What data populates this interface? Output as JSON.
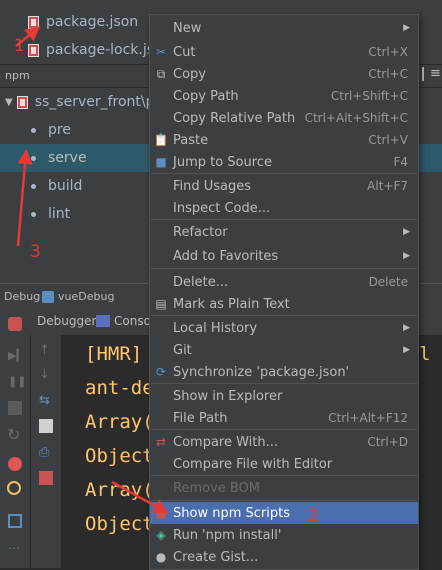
{
  "project_tree": {
    "files": [
      "package.json",
      "package-lock.json"
    ],
    "npm_label": "npm",
    "root_node": "ss_server_front\\package.json",
    "scripts": [
      "pre",
      "serve",
      "build",
      "lint"
    ]
  },
  "debug": {
    "tool_window_label": "Debug",
    "config_name": "vueDebug",
    "tabs": [
      "Debugger",
      "Console"
    ],
    "console_lines": [
      "[HMR]",
      "ant-de",
      "Array(",
      "Object",
      "Array(",
      "Object"
    ],
    "console_line_tail": "l"
  },
  "context_menu": {
    "items": [
      {
        "label": "New",
        "submenu": true
      },
      {
        "label": "Cut",
        "key": "Ctrl+X",
        "icon": "scissors-icon"
      },
      {
        "label": "Copy",
        "key": "Ctrl+C",
        "icon": "copy-icon"
      },
      {
        "label": "Copy Path",
        "key": "Ctrl+Shift+C"
      },
      {
        "label": "Copy Relative Path",
        "key": "Ctrl+Alt+Shift+C"
      },
      {
        "label": "Paste",
        "key": "Ctrl+V",
        "icon": "paste-icon"
      },
      {
        "label": "Jump to Source",
        "key": "F4",
        "icon": "jump-icon"
      },
      {
        "label": "Find Usages",
        "key": "Alt+F7"
      },
      {
        "label": "Inspect Code..."
      },
      {
        "label": "Refactor",
        "submenu": true
      },
      {
        "label": "Add to Favorites",
        "submenu": true
      },
      {
        "label": "Delete...",
        "key": "Delete"
      },
      {
        "label": "Mark as Plain Text",
        "icon": "plain-text-icon"
      },
      {
        "label": "Local History",
        "submenu": true
      },
      {
        "label": "Git",
        "submenu": true
      },
      {
        "label": "Synchronize 'package.json'",
        "icon": "sync-icon"
      },
      {
        "label": "Show in Explorer"
      },
      {
        "label": "File Path",
        "key": "Ctrl+Alt+F12"
      },
      {
        "label": "Compare With...",
        "key": "Ctrl+D",
        "icon": "compare-icon"
      },
      {
        "label": "Compare File with Editor"
      },
      {
        "label": "Remove BOM",
        "disabled": true
      },
      {
        "label": "Show npm Scripts",
        "icon": "npm-icon",
        "highlighted": true
      },
      {
        "label": "Run 'npm install'",
        "icon": "npm-install-icon"
      },
      {
        "label": "Create Gist...",
        "icon": "github-icon"
      }
    ]
  },
  "annotations": [
    "1",
    "2",
    "3"
  ],
  "colors": {
    "annotation": "#e53935",
    "highlight": "#4b6eaf",
    "selection": "#2d5a6b",
    "console_text": "#ffc66d"
  }
}
